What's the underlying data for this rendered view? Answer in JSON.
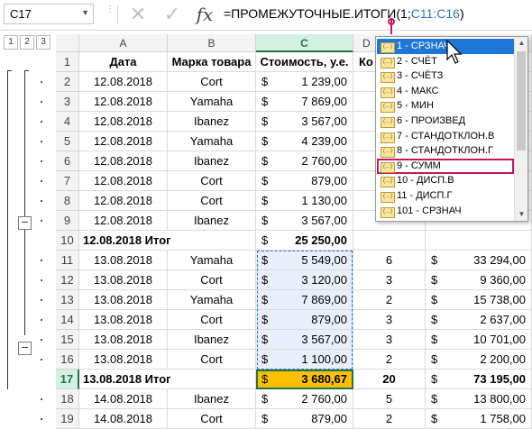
{
  "name_box": "C17",
  "formula_bar": {
    "func": "=ПРОМЕЖУТОЧНЫЕ.ИТОГИ(",
    "arg1": "1;",
    "ref": "C11:C16",
    "close": ")"
  },
  "outline_levels": [
    "1",
    "2",
    "3"
  ],
  "columns": [
    "A",
    "B",
    "C",
    "D"
  ],
  "header_row": {
    "row": "1",
    "date": "Дата",
    "brand": "Марка товара",
    "cost": "Стоимость, у.е.",
    "qty": "Ко"
  },
  "rows": [
    {
      "row": "2",
      "date": "12.08.2018",
      "brand": "Cort",
      "cur": "$",
      "cost": "1 239,00"
    },
    {
      "row": "3",
      "date": "12.08.2018",
      "brand": "Yamaha",
      "cur": "$",
      "cost": "7 869,00"
    },
    {
      "row": "4",
      "date": "12.08.2018",
      "brand": "Ibanez",
      "cur": "$",
      "cost": "3 567,00"
    },
    {
      "row": "5",
      "date": "12.08.2018",
      "brand": "Yamaha",
      "cur": "$",
      "cost": "4 239,00"
    },
    {
      "row": "6",
      "date": "12.08.2018",
      "brand": "Ibanez",
      "cur": "$",
      "cost": "2 760,00"
    },
    {
      "row": "7",
      "date": "12.08.2018",
      "brand": "Cort",
      "cur": "$",
      "cost": "879,00"
    },
    {
      "row": "8",
      "date": "12.08.2018",
      "brand": "Cort",
      "cur": "$",
      "cost": "1 130,00"
    },
    {
      "row": "9",
      "date": "12.08.2018",
      "brand": "Ibanez",
      "cur": "$",
      "cost": "3 567,00"
    },
    {
      "row": "10",
      "date": "12.08.2018 Итог",
      "brand": "",
      "cur": "$",
      "cost": "25 250,00",
      "qty": "",
      "total_cur": "",
      "total": ""
    },
    {
      "row": "11",
      "date": "13.08.2018",
      "brand": "Yamaha",
      "cur": "$",
      "cost": "5 549,00",
      "qty": "6",
      "total_cur": "$",
      "total": "33 294,00"
    },
    {
      "row": "12",
      "date": "13.08.2018",
      "brand": "Cort",
      "cur": "$",
      "cost": "3 120,00",
      "qty": "3",
      "total_cur": "$",
      "total": "9 360,00"
    },
    {
      "row": "13",
      "date": "13.08.2018",
      "brand": "Yamaha",
      "cur": "$",
      "cost": "7 869,00",
      "qty": "2",
      "total_cur": "$",
      "total": "15 738,00"
    },
    {
      "row": "14",
      "date": "13.08.2018",
      "brand": "Cort",
      "cur": "$",
      "cost": "879,00",
      "qty": "3",
      "total_cur": "$",
      "total": "2 637,00"
    },
    {
      "row": "15",
      "date": "13.08.2018",
      "brand": "Ibanez",
      "cur": "$",
      "cost": "3 567,00",
      "qty": "3",
      "total_cur": "$",
      "total": "10 701,00"
    },
    {
      "row": "16",
      "date": "13.08.2018",
      "brand": "Cort",
      "cur": "$",
      "cost": "1 100,00",
      "qty": "2",
      "total_cur": "$",
      "total": "2 200,00"
    },
    {
      "row": "17",
      "date": "13.08.2018 Итог",
      "brand": "",
      "cur": "$",
      "cost": "3 680,67",
      "qty": "20",
      "total_cur": "$",
      "total": "73 195,00"
    },
    {
      "row": "18",
      "date": "14.08.2018",
      "brand": "Ibanez",
      "cur": "$",
      "cost": "2 760,00",
      "qty": "5",
      "total_cur": "$",
      "total": "13 800,00"
    },
    {
      "row": "19",
      "date": "14.08.2018",
      "brand": "Cort",
      "cur": "$",
      "cost": "879,00",
      "qty": "2",
      "total_cur": "$",
      "total": "1 758,00"
    }
  ],
  "dropdown": {
    "options": [
      "1 - СРЗНАЧ",
      "2 - СЧЁТ",
      "3 - СЧЁТЗ",
      "4 - МАКС",
      "5 - МИН",
      "6 - ПРОИЗВЕД",
      "7 - СТАНДОТКЛОН.В",
      "8 - СТАНДОТКЛОН.Г",
      "9 - СУММ",
      "10 - ДИСП.В",
      "11 - ДИСП.Г",
      "101 - СРЗНАЧ"
    ],
    "selected_index": 0,
    "highlighted_index": 8
  },
  "colors": {
    "selection_green": "#217346",
    "dropdown_selected": "#1e76d6",
    "highlight_outline": "#c2185b",
    "active_cell_fill": "#ffc000",
    "range_fill": "#e8effa"
  }
}
